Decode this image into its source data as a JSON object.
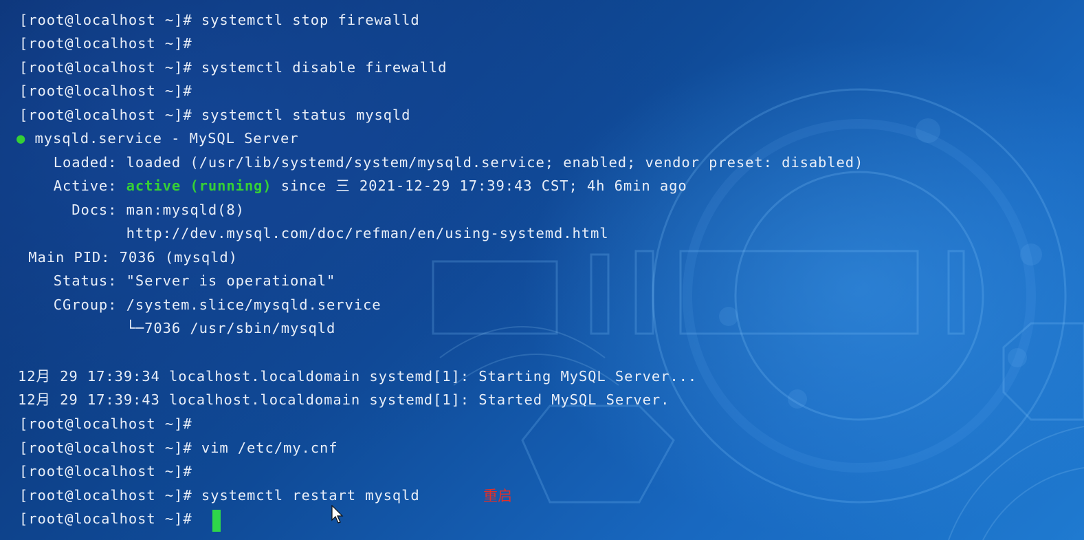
{
  "terminal": {
    "lines": [
      "[root@localhost ~]# systemctl stop firewalld",
      "[root@localhost ~]#",
      "[root@localhost ~]# systemctl disable firewalld",
      "[root@localhost ~]#",
      "[root@localhost ~]# systemctl status mysqld",
      "mysqld.service - MySQL Server",
      "   Loaded: loaded (/usr/lib/systemd/system/mysqld.service; enabled; vendor preset: disabled)",
      "   Active: ",
      "     Docs: man:mysqld(8)",
      "           http://dev.mysql.com/doc/refman/en/using-systemd.html",
      " Main PID: 7036 (mysqld)",
      "   Status: \"Server is operational\"",
      "   CGroup: /system.slice/mysqld.service",
      "           └─7036 /usr/sbin/mysqld",
      "12月 29 17:39:34 localhost.localdomain systemd[1]: Starting MySQL Server...",
      "12月 29 17:39:43 localhost.localdomain systemd[1]: Started MySQL Server.",
      "[root@localhost ~]#",
      "[root@localhost ~]# vim /etc/my.cnf",
      "[root@localhost ~]#",
      "[root@localhost ~]# systemctl restart mysqld",
      "[root@localhost ~]# "
    ],
    "status_dot": "●",
    "active_state": "active (running)",
    "active_rest": " since 三 2021-12-29 17:39:43 CST; 4h 6min ago",
    "annotation": "重启"
  },
  "colors": {
    "text": "#e8eef8",
    "active_green": "#35d035",
    "cursor_green": "#2fd64a",
    "annotation_red": "#e0302a",
    "background_dark": "#0b2f6e",
    "background_light": "#1f7ad0"
  },
  "icons": {
    "status_dot": "green-status-dot-icon",
    "mouse_pointer": "mouse-pointer-icon"
  }
}
